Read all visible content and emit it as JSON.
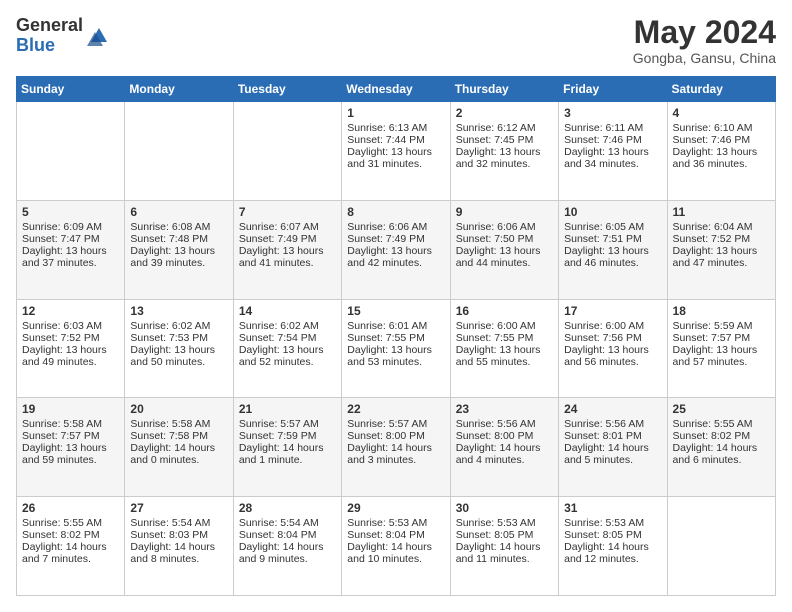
{
  "header": {
    "logo_general": "General",
    "logo_blue": "Blue",
    "month_title": "May 2024",
    "location": "Gongba, Gansu, China"
  },
  "days_of_week": [
    "Sunday",
    "Monday",
    "Tuesday",
    "Wednesday",
    "Thursday",
    "Friday",
    "Saturday"
  ],
  "weeks": [
    [
      {
        "day": "",
        "content": ""
      },
      {
        "day": "",
        "content": ""
      },
      {
        "day": "",
        "content": ""
      },
      {
        "day": "1",
        "content": "Sunrise: 6:13 AM\nSunset: 7:44 PM\nDaylight: 13 hours\nand 31 minutes."
      },
      {
        "day": "2",
        "content": "Sunrise: 6:12 AM\nSunset: 7:45 PM\nDaylight: 13 hours\nand 32 minutes."
      },
      {
        "day": "3",
        "content": "Sunrise: 6:11 AM\nSunset: 7:46 PM\nDaylight: 13 hours\nand 34 minutes."
      },
      {
        "day": "4",
        "content": "Sunrise: 6:10 AM\nSunset: 7:46 PM\nDaylight: 13 hours\nand 36 minutes."
      }
    ],
    [
      {
        "day": "5",
        "content": "Sunrise: 6:09 AM\nSunset: 7:47 PM\nDaylight: 13 hours\nand 37 minutes."
      },
      {
        "day": "6",
        "content": "Sunrise: 6:08 AM\nSunset: 7:48 PM\nDaylight: 13 hours\nand 39 minutes."
      },
      {
        "day": "7",
        "content": "Sunrise: 6:07 AM\nSunset: 7:49 PM\nDaylight: 13 hours\nand 41 minutes."
      },
      {
        "day": "8",
        "content": "Sunrise: 6:06 AM\nSunset: 7:49 PM\nDaylight: 13 hours\nand 42 minutes."
      },
      {
        "day": "9",
        "content": "Sunrise: 6:06 AM\nSunset: 7:50 PM\nDaylight: 13 hours\nand 44 minutes."
      },
      {
        "day": "10",
        "content": "Sunrise: 6:05 AM\nSunset: 7:51 PM\nDaylight: 13 hours\nand 46 minutes."
      },
      {
        "day": "11",
        "content": "Sunrise: 6:04 AM\nSunset: 7:52 PM\nDaylight: 13 hours\nand 47 minutes."
      }
    ],
    [
      {
        "day": "12",
        "content": "Sunrise: 6:03 AM\nSunset: 7:52 PM\nDaylight: 13 hours\nand 49 minutes."
      },
      {
        "day": "13",
        "content": "Sunrise: 6:02 AM\nSunset: 7:53 PM\nDaylight: 13 hours\nand 50 minutes."
      },
      {
        "day": "14",
        "content": "Sunrise: 6:02 AM\nSunset: 7:54 PM\nDaylight: 13 hours\nand 52 minutes."
      },
      {
        "day": "15",
        "content": "Sunrise: 6:01 AM\nSunset: 7:55 PM\nDaylight: 13 hours\nand 53 minutes."
      },
      {
        "day": "16",
        "content": "Sunrise: 6:00 AM\nSunset: 7:55 PM\nDaylight: 13 hours\nand 55 minutes."
      },
      {
        "day": "17",
        "content": "Sunrise: 6:00 AM\nSunset: 7:56 PM\nDaylight: 13 hours\nand 56 minutes."
      },
      {
        "day": "18",
        "content": "Sunrise: 5:59 AM\nSunset: 7:57 PM\nDaylight: 13 hours\nand 57 minutes."
      }
    ],
    [
      {
        "day": "19",
        "content": "Sunrise: 5:58 AM\nSunset: 7:57 PM\nDaylight: 13 hours\nand 59 minutes."
      },
      {
        "day": "20",
        "content": "Sunrise: 5:58 AM\nSunset: 7:58 PM\nDaylight: 14 hours\nand 0 minutes."
      },
      {
        "day": "21",
        "content": "Sunrise: 5:57 AM\nSunset: 7:59 PM\nDaylight: 14 hours\nand 1 minute."
      },
      {
        "day": "22",
        "content": "Sunrise: 5:57 AM\nSunset: 8:00 PM\nDaylight: 14 hours\nand 3 minutes."
      },
      {
        "day": "23",
        "content": "Sunrise: 5:56 AM\nSunset: 8:00 PM\nDaylight: 14 hours\nand 4 minutes."
      },
      {
        "day": "24",
        "content": "Sunrise: 5:56 AM\nSunset: 8:01 PM\nDaylight: 14 hours\nand 5 minutes."
      },
      {
        "day": "25",
        "content": "Sunrise: 5:55 AM\nSunset: 8:02 PM\nDaylight: 14 hours\nand 6 minutes."
      }
    ],
    [
      {
        "day": "26",
        "content": "Sunrise: 5:55 AM\nSunset: 8:02 PM\nDaylight: 14 hours\nand 7 minutes."
      },
      {
        "day": "27",
        "content": "Sunrise: 5:54 AM\nSunset: 8:03 PM\nDaylight: 14 hours\nand 8 minutes."
      },
      {
        "day": "28",
        "content": "Sunrise: 5:54 AM\nSunset: 8:04 PM\nDaylight: 14 hours\nand 9 minutes."
      },
      {
        "day": "29",
        "content": "Sunrise: 5:53 AM\nSunset: 8:04 PM\nDaylight: 14 hours\nand 10 minutes."
      },
      {
        "day": "30",
        "content": "Sunrise: 5:53 AM\nSunset: 8:05 PM\nDaylight: 14 hours\nand 11 minutes."
      },
      {
        "day": "31",
        "content": "Sunrise: 5:53 AM\nSunset: 8:05 PM\nDaylight: 14 hours\nand 12 minutes."
      },
      {
        "day": "",
        "content": ""
      }
    ]
  ]
}
